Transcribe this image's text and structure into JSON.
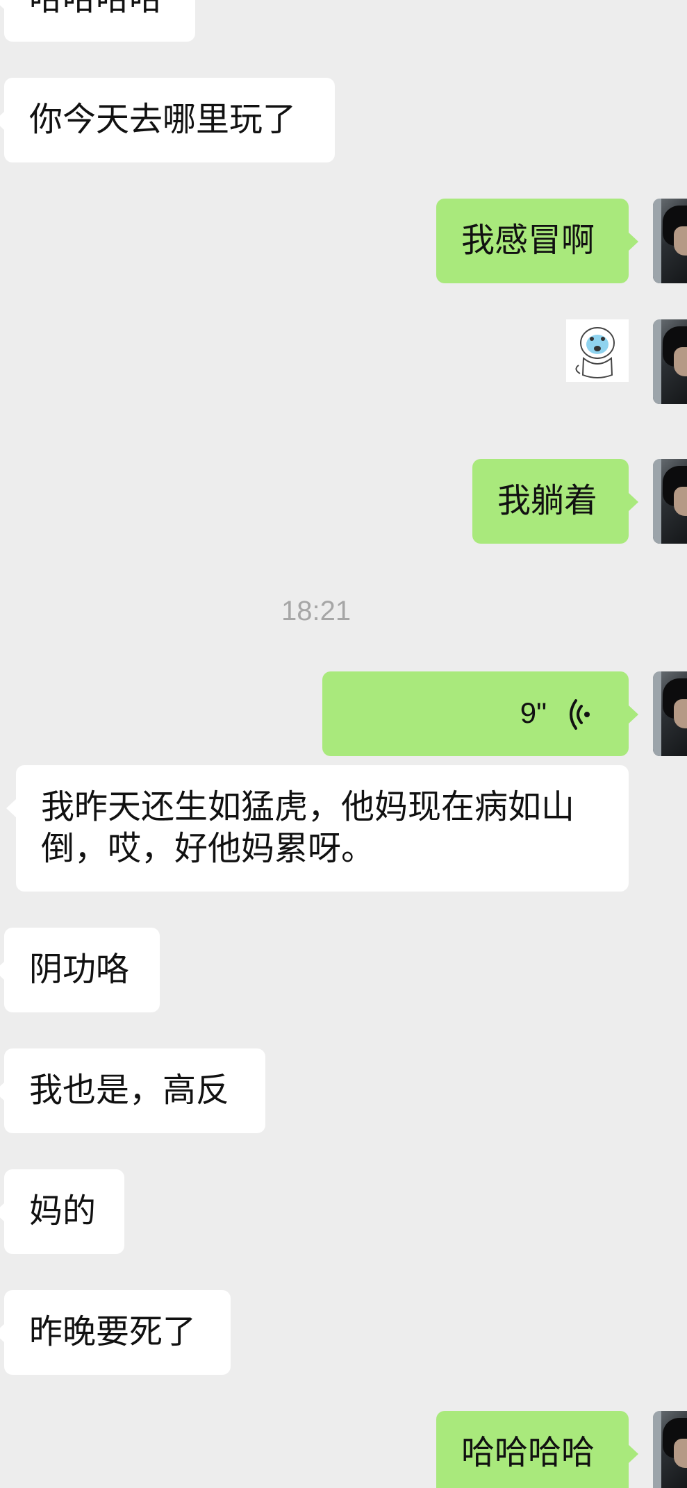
{
  "messages": [
    {
      "side": "left",
      "text": "哈哈哈哈"
    },
    {
      "side": "left",
      "text": "你今天去哪里玩了"
    },
    {
      "side": "right",
      "text": "我感冒啊"
    },
    {
      "side": "right",
      "sticker": "crying-face-sticker"
    },
    {
      "side": "right",
      "text": "我躺着"
    },
    {
      "side": "right",
      "voice_duration": "9\""
    },
    {
      "side": "left",
      "text_line1": "我昨天还生如猛虎，他妈现在病如山",
      "text_line2": "倒，哎，好他妈累呀。"
    },
    {
      "side": "left",
      "text": "阴功咯"
    },
    {
      "side": "left",
      "text": "我也是，高反"
    },
    {
      "side": "left",
      "text": "妈的"
    },
    {
      "side": "left",
      "text": "昨晚要死了"
    },
    {
      "side": "right",
      "text": "哈哈哈哈"
    }
  ],
  "timestamp": "18:21",
  "colors": {
    "background": "#ededed",
    "incoming_bubble": "#ffffff",
    "outgoing_bubble": "#a9e97c",
    "timestamp_text": "#a6a6a6"
  }
}
